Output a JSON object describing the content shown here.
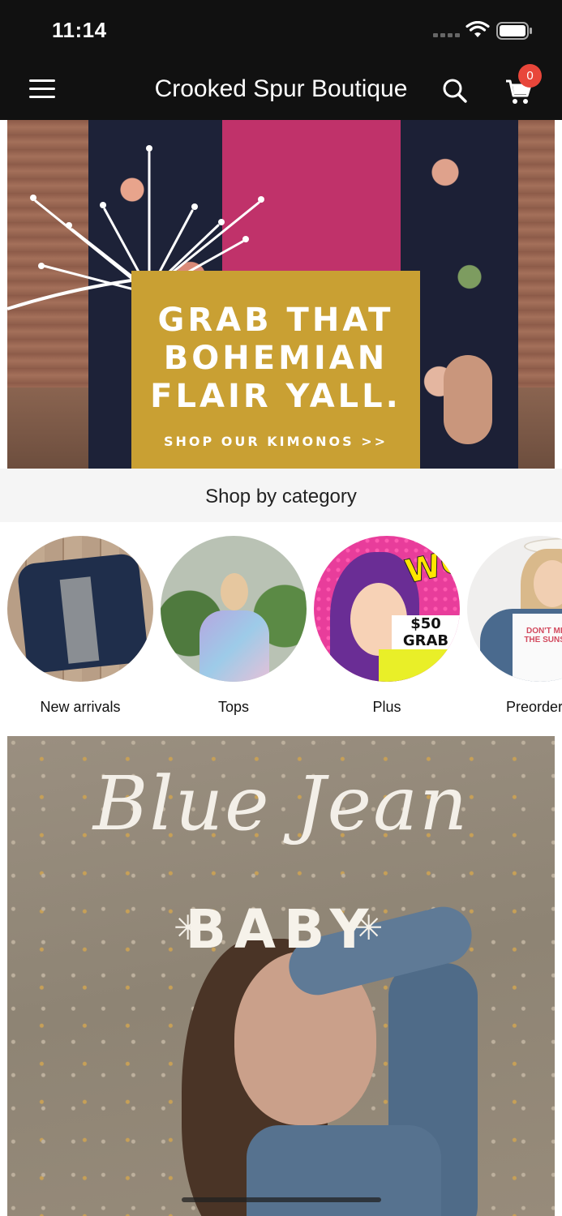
{
  "status_bar": {
    "time": "11:14"
  },
  "navbar": {
    "title": "Crooked Spur Boutique",
    "cart_count": "0"
  },
  "hero": {
    "headline_lines": [
      "GRAB THAT",
      "BOHEMIAN",
      "FLAIR YALL."
    ],
    "cta": "SHOP OUR KIMONOS >>"
  },
  "categories": {
    "heading": "Shop by category",
    "items": [
      {
        "label": "New arrivals"
      },
      {
        "label": "Tops"
      },
      {
        "label": "Plus",
        "image_text": [
          "WOW",
          "$50 GRAB"
        ]
      },
      {
        "label": "Preorder it",
        "image_text": [
          "DON'T MISS",
          "THE SUNSET"
        ]
      }
    ]
  },
  "promo": {
    "script": "Blue Jean",
    "word": "BABY"
  },
  "colors": {
    "bar": "#111111",
    "badge": "#e8463a",
    "hero_box": "#c9a033"
  },
  "icons": [
    "menu-icon",
    "search-icon",
    "cart-icon",
    "wifi-icon",
    "battery-icon"
  ]
}
